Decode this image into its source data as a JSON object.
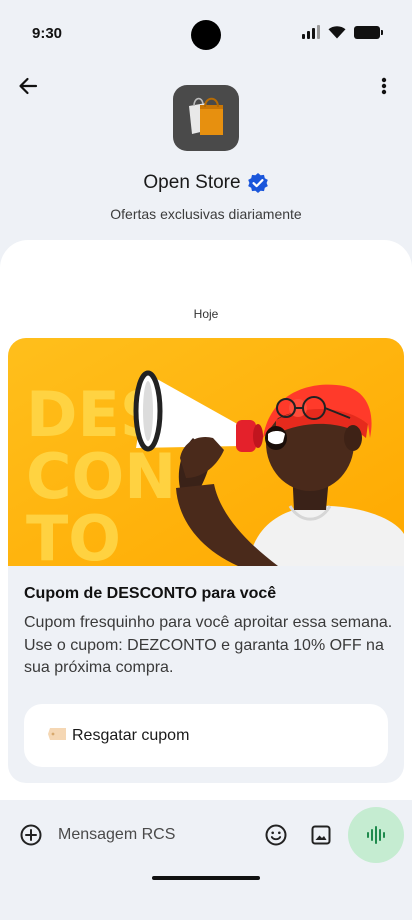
{
  "status_bar": {
    "time": "9:30"
  },
  "header": {
    "store_name": "Open Store",
    "tagline": "Ofertas exclusivas diariamente"
  },
  "chat": {
    "date_label": "Hoje",
    "card": {
      "media_text_lines": [
        "DES",
        "CON",
        "TO"
      ],
      "title": "Cupom de DESCONTO para você",
      "description": "Cupom fresquinho para você aproitar essa semana. Use o cupom: DEZCONTO e garanta 10% OFF na sua próxima compra.",
      "action_icon": "🏷️",
      "action_label": "Resgatar cupom"
    }
  },
  "composer": {
    "placeholder": "Mensagem RCS"
  },
  "colors": {
    "accent_blue": "#1a56db",
    "voice_button_bg": "#c5ecd1",
    "voice_icon": "#1e8a4c",
    "banner_orange": "#ffb400"
  }
}
